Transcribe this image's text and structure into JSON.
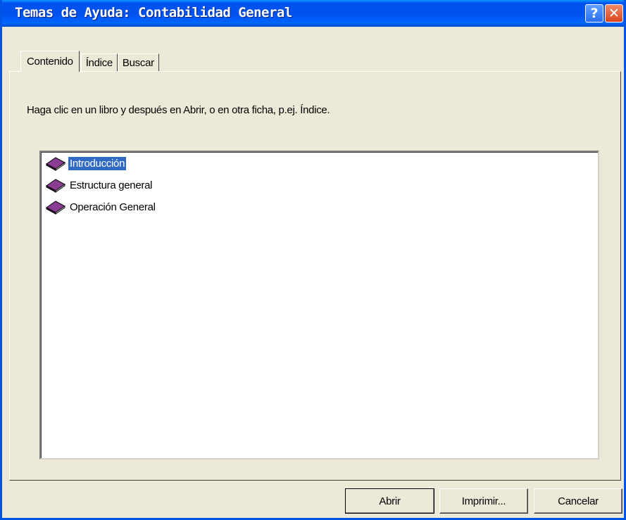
{
  "window": {
    "title": "Temas de Ayuda: Contabilidad General",
    "help_glyph": "?",
    "close_glyph": "✕"
  },
  "tabs": [
    {
      "label": "Contenido",
      "active": true
    },
    {
      "label": "Índice",
      "active": false
    },
    {
      "label": "Buscar",
      "active": false
    }
  ],
  "content": {
    "instruction": "Haga clic en un libro y después en Abrir, o en otra ficha, p.ej. Índice.",
    "items": [
      {
        "label": "Introducción",
        "icon": "book-icon",
        "selected": true
      },
      {
        "label": "Estructura general",
        "icon": "book-icon",
        "selected": false
      },
      {
        "label": "Operación General",
        "icon": "book-icon",
        "selected": false
      }
    ]
  },
  "buttons": {
    "open_label": "Abrir",
    "print_label": "Imprimir...",
    "cancel_label": "Cancelar"
  },
  "colors": {
    "title_bar": "#0053ee",
    "selection": "#316ac5",
    "book": "#6a2a72"
  }
}
